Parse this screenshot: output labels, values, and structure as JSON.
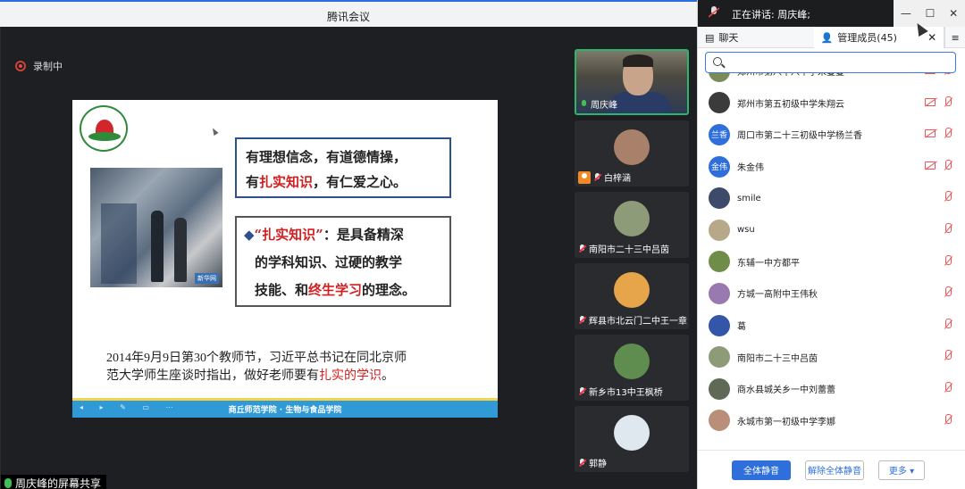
{
  "window": {
    "title": "腾讯会议"
  },
  "recording": {
    "label": "录制中"
  },
  "slide": {
    "box1_line1": "有理想信念，有道德情操，",
    "box1_line2_a": "有",
    "box1_line2_red": "扎实知识",
    "box1_line2_b": "，有仁爱之心。",
    "box2_bullet": "◆",
    "box2_line1_red": "“扎实知识”",
    "box2_line1_b": "：是具备精深",
    "box2_line2": "的学科知识、过硬的教学",
    "box2_line3_a": "技能、和",
    "box2_line3_red": "终生学习",
    "box2_line3_b": "的理念。",
    "para_line1": "2014年9月9日第30个教师节，习近平总书记在同北京师",
    "para_line2_a": "范大学师生座谈时指出，做好老师要有",
    "para_line2_red": "扎实的学识",
    "para_line2_b": "。",
    "footer": "商丘师范学院 · 生物与食品学院",
    "footer_controls": "◂ ▸ ✎ ▭ ⋯",
    "photo_stamp": "新华网"
  },
  "sharer": {
    "label": "周庆峰的屏幕共享"
  },
  "videos": [
    {
      "name": "周庆峰",
      "type": "camera",
      "active": true
    },
    {
      "name": "白梓涵",
      "type": "avatar",
      "color": "#a9806a"
    },
    {
      "name": "南阳市二十三中吕茵",
      "type": "avatar",
      "color": "#8e9b79"
    },
    {
      "name": "辉县市北云门二中王一章",
      "type": "avatar",
      "color": "#e6a54a"
    },
    {
      "name": "新乡市13中王枫桥",
      "type": "avatar",
      "color": "#5f8d50"
    },
    {
      "name": "郭静",
      "type": "avatar",
      "color": "#dfe8ef"
    }
  ],
  "panel": {
    "speaking": "正在讲话: 周庆峰;",
    "tab_chat": "聊天",
    "tab_members": "管理成员(45)",
    "search_placeholder": "",
    "window_controls": {
      "min": "—",
      "max": "☐",
      "close": "✕"
    },
    "members": [
      {
        "name": "郑州市第八十八中学朱蔓蔓",
        "avatar_text": "",
        "color": "#7a8a58",
        "camoff": true
      },
      {
        "name": "郑州市第五初级中学朱翔云",
        "avatar_text": "",
        "color": "#3b3b3b",
        "camoff": true
      },
      {
        "name": "周口市第二十三初级中学杨兰香",
        "avatar_text": "兰香",
        "color": "#2f6fdc",
        "camoff": true
      },
      {
        "name": "朱金伟",
        "avatar_text": "金伟",
        "color": "#2f6fdc",
        "camoff": true
      },
      {
        "name": "smile",
        "avatar_text": "",
        "color": "#3d4a6a",
        "camoff": false
      },
      {
        "name": "wsu",
        "avatar_text": "",
        "color": "#b6a888",
        "camoff": false
      },
      {
        "name": "东辅一中方都平",
        "avatar_text": "",
        "color": "#6f8d48",
        "camoff": false
      },
      {
        "name": "方城一高附中王伟秋",
        "avatar_text": "",
        "color": "#9a78b0",
        "camoff": false
      },
      {
        "name": "葛",
        "avatar_text": "",
        "color": "#3456a8",
        "camoff": false
      },
      {
        "name": "南阳市二十三中吕茵",
        "avatar_text": "",
        "color": "#8e9b79",
        "camoff": false
      },
      {
        "name": "商水县城关乡一中刘蕾蕾",
        "avatar_text": "",
        "color": "#5e6a55",
        "camoff": false
      },
      {
        "name": "永城市第一初级中学李娜",
        "avatar_text": "",
        "color": "#b98f7a",
        "camoff": false
      }
    ],
    "btn_mute_all": "全体静音",
    "btn_unmute_all": "解除全体静音",
    "btn_more": "更多 ▾"
  }
}
